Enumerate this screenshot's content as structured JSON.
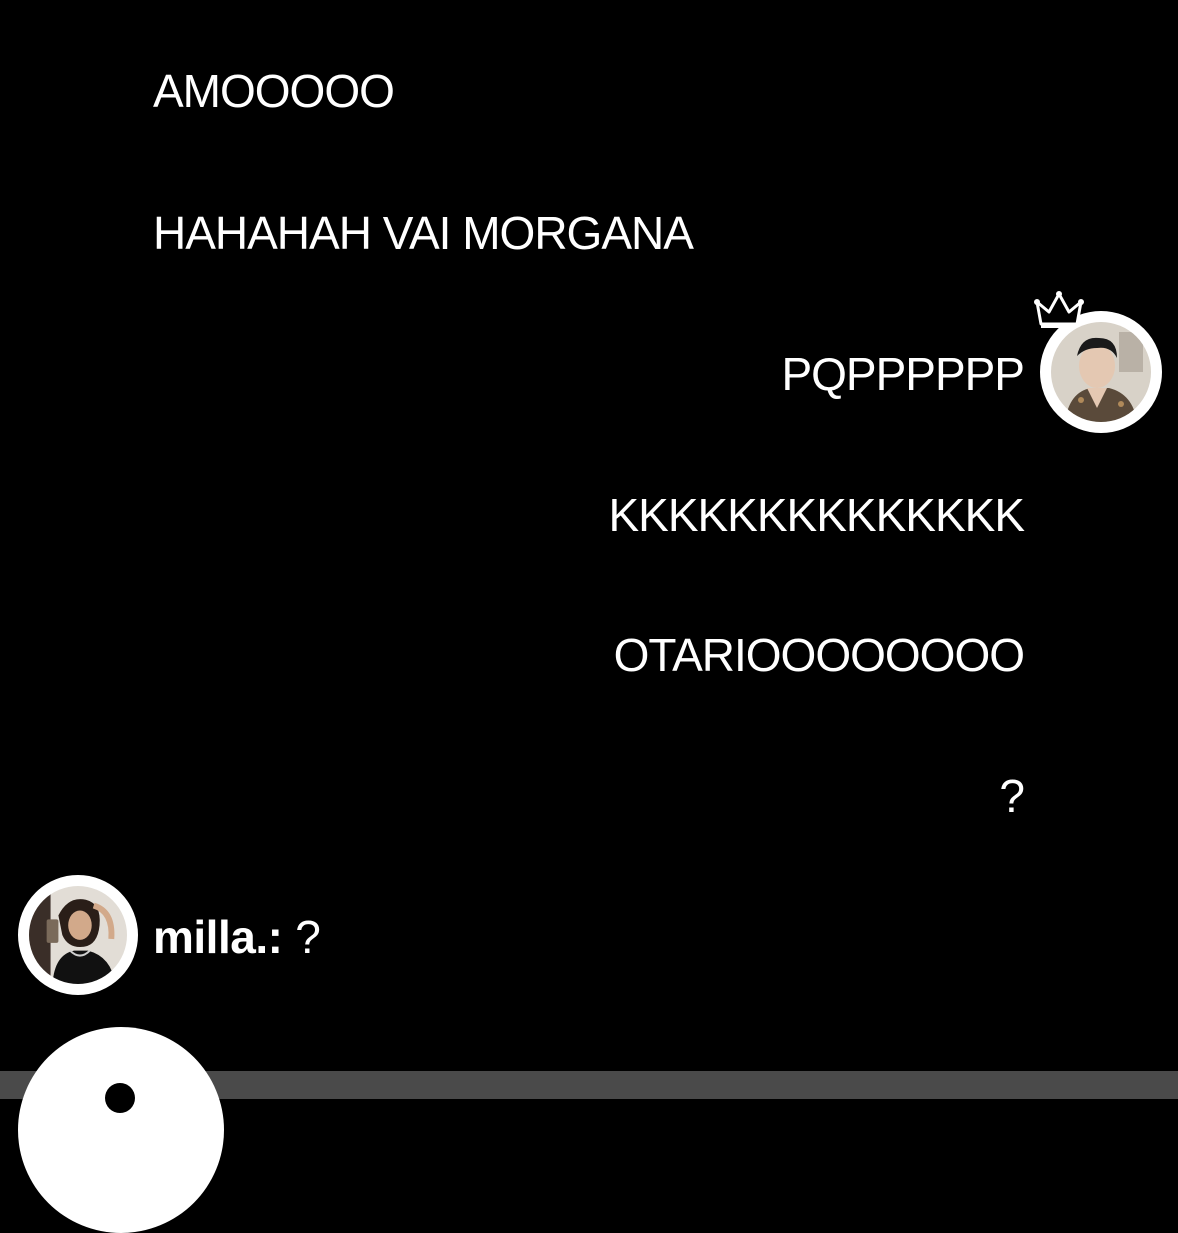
{
  "messages_left": [
    {
      "text": "AMOOOOO"
    },
    {
      "text": "HAHAHAH VAI MORGANA"
    }
  ],
  "messages_right": [
    {
      "text": "PQPPPPPP"
    },
    {
      "text": "KKKKKKKKKKKKKK"
    },
    {
      "text": "OTARIOOOOOOOO"
    },
    {
      "text": "?"
    }
  ],
  "comment": {
    "username": "milla.:",
    "text": "?"
  },
  "icons": {
    "host_badge": "crown-icon",
    "bottom_button": "camera-button"
  },
  "colors": {
    "background": "#000000",
    "text": "#ffffff",
    "bottom_bar": "#4a4a4a"
  }
}
